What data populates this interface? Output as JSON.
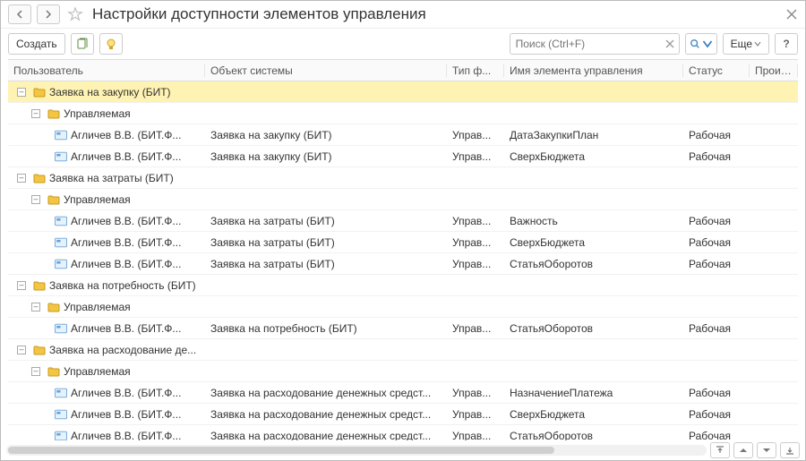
{
  "title": "Настройки доступности элементов управления",
  "toolbar": {
    "create": "Создать",
    "more": "Еще",
    "search_placeholder": "Поиск (Ctrl+F)"
  },
  "columns": {
    "user": "Пользователь",
    "object": "Объект системы",
    "form_type": "Тип ф...",
    "elem_name": "Имя элемента управления",
    "status": "Статус",
    "last": "Произво"
  },
  "rows": [
    {
      "kind": "group0",
      "sel": true,
      "user": "Заявка на закупку (БИТ)",
      "object": "",
      "ftype": "",
      "elem": "",
      "status": ""
    },
    {
      "kind": "group1",
      "sel": false,
      "user": "Управляемая",
      "object": "",
      "ftype": "",
      "elem": "",
      "status": ""
    },
    {
      "kind": "leaf",
      "sel": false,
      "user": "Агличев В.В. (БИТ.Ф...",
      "object": "Заявка на закупку (БИТ)",
      "ftype": "Управ...",
      "elem": "ДатаЗакупкиПлан",
      "status": "Рабочая"
    },
    {
      "kind": "leaf",
      "sel": false,
      "user": "Агличев В.В. (БИТ.Ф...",
      "object": "Заявка на закупку (БИТ)",
      "ftype": "Управ...",
      "elem": "СверхБюджета",
      "status": "Рабочая"
    },
    {
      "kind": "group0",
      "sel": false,
      "user": "Заявка на затраты (БИТ)",
      "object": "",
      "ftype": "",
      "elem": "",
      "status": ""
    },
    {
      "kind": "group1",
      "sel": false,
      "user": "Управляемая",
      "object": "",
      "ftype": "",
      "elem": "",
      "status": ""
    },
    {
      "kind": "leaf",
      "sel": false,
      "user": "Агличев В.В. (БИТ.Ф...",
      "object": "Заявка на затраты (БИТ)",
      "ftype": "Управ...",
      "elem": "Важность",
      "status": "Рабочая"
    },
    {
      "kind": "leaf",
      "sel": false,
      "user": "Агличев В.В. (БИТ.Ф...",
      "object": "Заявка на затраты (БИТ)",
      "ftype": "Управ...",
      "elem": "СверхБюджета",
      "status": "Рабочая"
    },
    {
      "kind": "leaf",
      "sel": false,
      "user": "Агличев В.В. (БИТ.Ф...",
      "object": "Заявка на затраты (БИТ)",
      "ftype": "Управ...",
      "elem": "СтатьяОборотов",
      "status": "Рабочая"
    },
    {
      "kind": "group0",
      "sel": false,
      "user": "Заявка на потребность (БИТ)",
      "object": "",
      "ftype": "",
      "elem": "",
      "status": ""
    },
    {
      "kind": "group1",
      "sel": false,
      "user": "Управляемая",
      "object": "",
      "ftype": "",
      "elem": "",
      "status": ""
    },
    {
      "kind": "leaf",
      "sel": false,
      "user": "Агличев В.В. (БИТ.Ф...",
      "object": "Заявка на потребность (БИТ)",
      "ftype": "Управ...",
      "elem": "СтатьяОборотов",
      "status": "Рабочая"
    },
    {
      "kind": "group0",
      "sel": false,
      "user": "Заявка на расходование де...",
      "object": "",
      "ftype": "",
      "elem": "",
      "status": ""
    },
    {
      "kind": "group1",
      "sel": false,
      "user": "Управляемая",
      "object": "",
      "ftype": "",
      "elem": "",
      "status": ""
    },
    {
      "kind": "leaf",
      "sel": false,
      "user": "Агличев В.В. (БИТ.Ф...",
      "object": "Заявка на расходование денежных средст...",
      "ftype": "Управ...",
      "elem": "НазначениеПлатежа",
      "status": "Рабочая"
    },
    {
      "kind": "leaf",
      "sel": false,
      "user": "Агличев В.В. (БИТ.Ф...",
      "object": "Заявка на расходование денежных средст...",
      "ftype": "Управ...",
      "elem": "СверхБюджета",
      "status": "Рабочая"
    },
    {
      "kind": "leaf",
      "sel": false,
      "user": "Агличев В.В. (БИТ.Ф...",
      "object": "Заявка на расходование денежных средст...",
      "ftype": "Управ...",
      "elem": "СтатьяОборотов",
      "status": "Рабочая"
    }
  ]
}
